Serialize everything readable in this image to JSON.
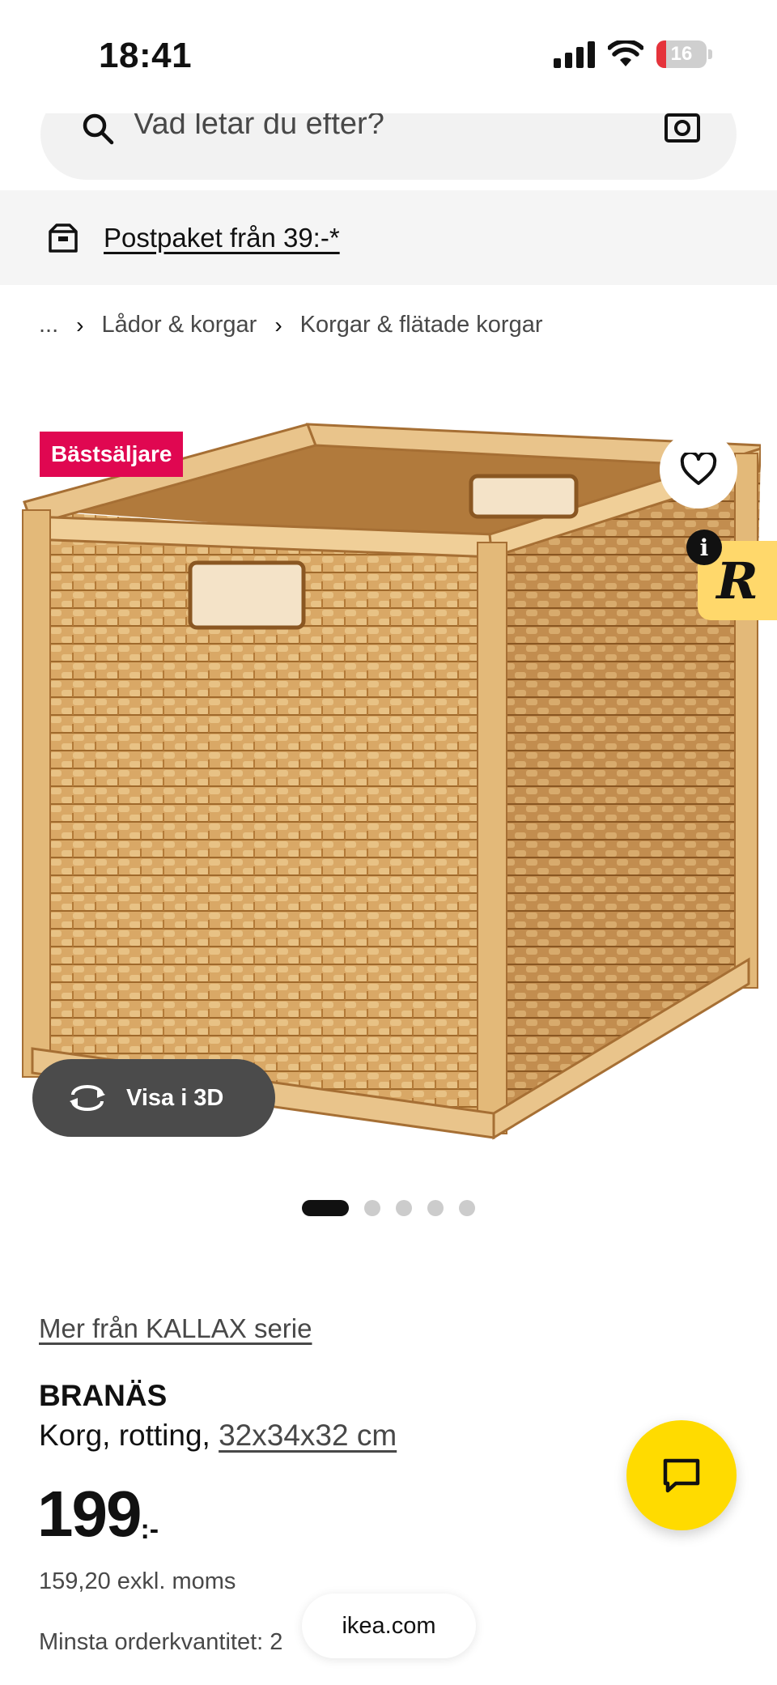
{
  "status_bar": {
    "time": "18:41",
    "battery": "16",
    "battery_color": "#e5333b"
  },
  "search": {
    "placeholder": "Vad letar du efter?",
    "icon": "search-icon",
    "camera_icon": "camera-icon"
  },
  "promo": {
    "icon": "box-icon",
    "text": "Postpaket från 39:-*"
  },
  "breadcrumb": {
    "items": [
      "...",
      "Lådor & korgar",
      "Korgar & flätade korgar"
    ],
    "separator": "›"
  },
  "product_media": {
    "badge": "Bästsäljare",
    "badge_color": "#e00751",
    "favorite_icon": "heart-icon",
    "r_badge_label": "R",
    "info_label": "i",
    "view_3d_label": "Visa i 3D",
    "view_3d_icon": "rotate-3d-icon",
    "carousel": {
      "total": 5,
      "active": 1
    }
  },
  "product": {
    "series_link": "Mer från KALLAX serie",
    "name": "BRANÄS",
    "description": "Korg, rotting, ",
    "dimensions": "32x34x32 cm",
    "price_int": "199",
    "price_suffix": ":-",
    "price_ex_vat": "159,20 exkl. moms",
    "min_order": "Minsta orderkvantitet: 2"
  },
  "chat": {
    "icon": "chat-icon",
    "color": "#ffdb00"
  },
  "browser": {
    "url": "ikea.com"
  }
}
